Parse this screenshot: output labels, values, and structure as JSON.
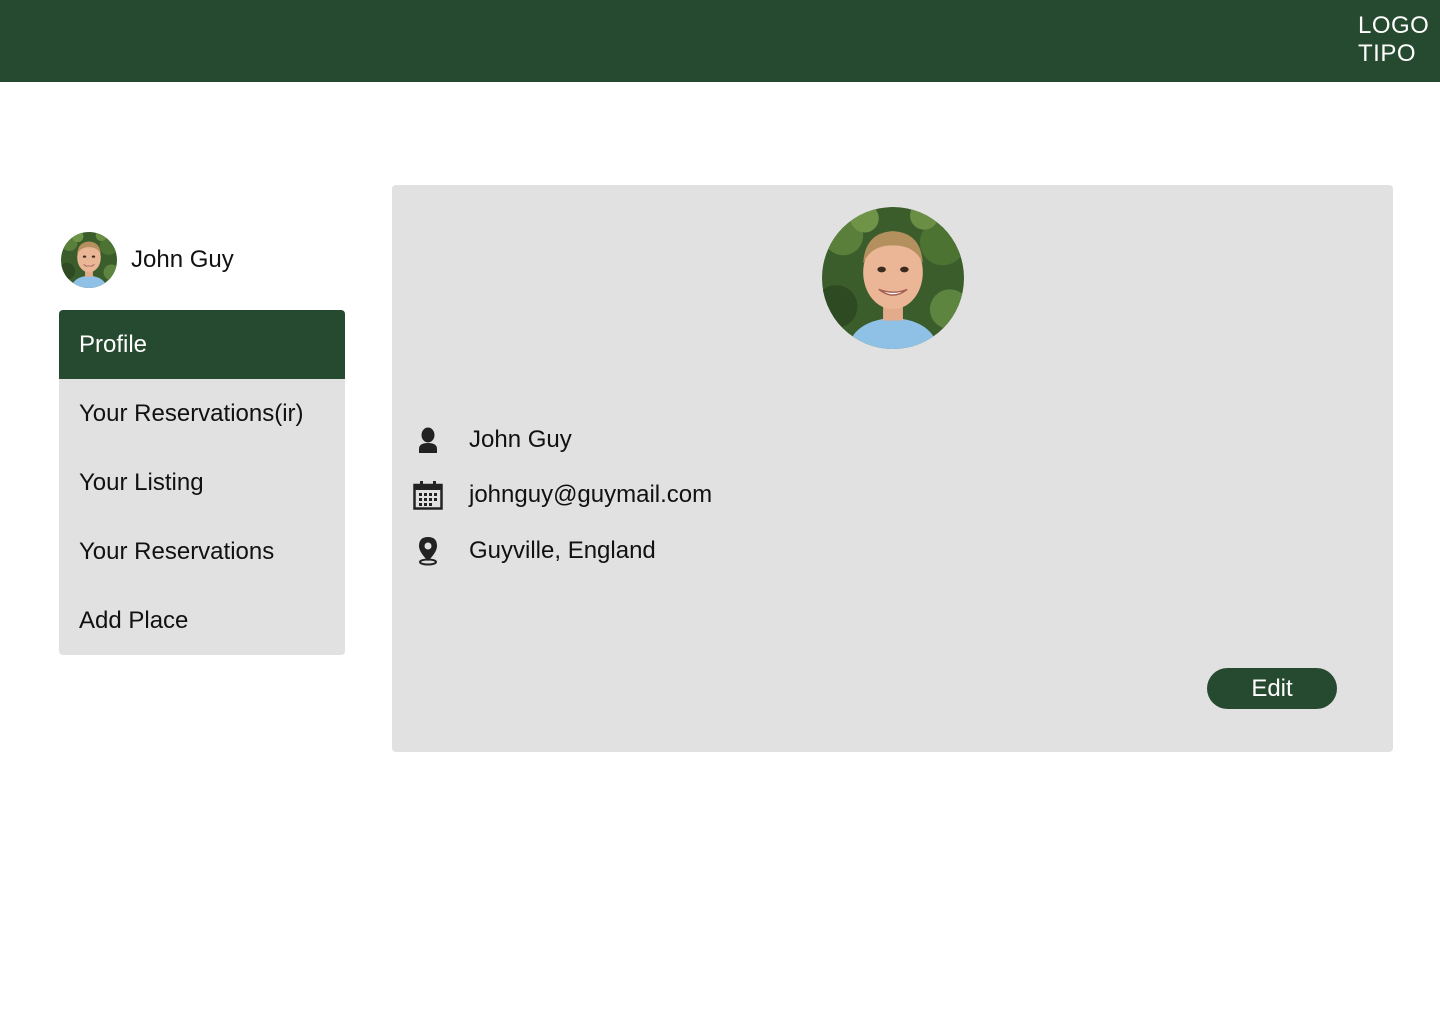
{
  "header": {
    "logo_line1": "LOGO",
    "logo_line2": "TIPO",
    "background_color": "#264a2f"
  },
  "user": {
    "name": "John Guy",
    "avatar_icon": "user-photo"
  },
  "sidebar": {
    "items": [
      {
        "label": "Profile",
        "active": true
      },
      {
        "label": "Your Reservations(ir)",
        "active": false
      },
      {
        "label": "Your Listing",
        "active": false
      },
      {
        "label": "Your Reservations",
        "active": false
      },
      {
        "label": "Add Place",
        "active": false
      }
    ]
  },
  "profile": {
    "name": "John Guy",
    "email": "johnguy@guymail.com",
    "location": "Guyville, England",
    "icons": {
      "name": "person-icon",
      "email": "calendar-icon",
      "location": "map-pin-icon"
    },
    "edit_label": "Edit"
  },
  "colors": {
    "accent": "#264a2f",
    "panel": "#e1e1e1",
    "text": "#111111"
  }
}
